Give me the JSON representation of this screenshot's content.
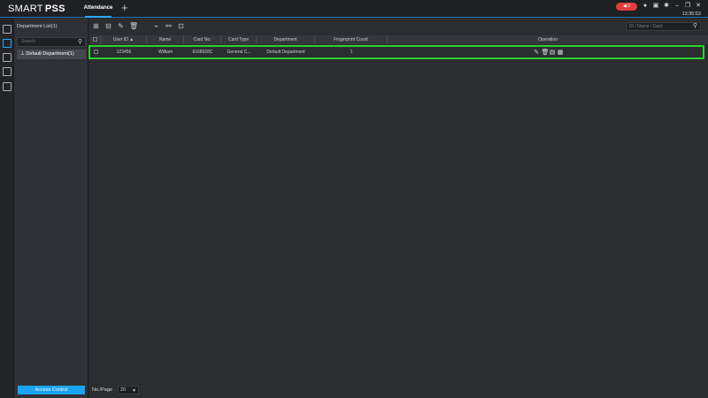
{
  "app": {
    "brand_a": "SMART",
    "brand_b": "PSS"
  },
  "tabs": [
    {
      "label": "Attendance"
    }
  ],
  "add_tab": "+",
  "alarm": {
    "count": "0"
  },
  "clock": "13:35:53",
  "department": {
    "title": "Department List(1)",
    "search_placeholder": "Search",
    "items": [
      {
        "label": "Default Department(1)"
      }
    ]
  },
  "filter": {
    "placeholder": "ID / Name / Card"
  },
  "table": {
    "headers": [
      "User ID",
      "Name",
      "Card No.",
      "Card Type",
      "Department",
      "Fingerprint Count",
      "Operation"
    ],
    "rows": [
      {
        "user_id": "123456",
        "name": "William",
        "card_no": "6168928C",
        "card_type": "General C...",
        "department": "Default Department",
        "fingerprint_count": "1"
      }
    ]
  },
  "footer": {
    "per_page_label": "No./Page",
    "per_page_value": "20",
    "access_button": "Access Control"
  },
  "icons": {
    "toolbar": [
      "add-user-icon",
      "add-card-icon",
      "edit-icon",
      "delete-icon",
      "fingerprint-icon",
      "broom-icon",
      "export-icon"
    ],
    "operations": [
      "edit-icon",
      "delete-icon",
      "card-icon",
      "fingerprint-record-icon"
    ]
  },
  "colors": {
    "accent": "#19a3f0",
    "highlight": "#2bd12b",
    "alarm": "#e63b3b"
  }
}
